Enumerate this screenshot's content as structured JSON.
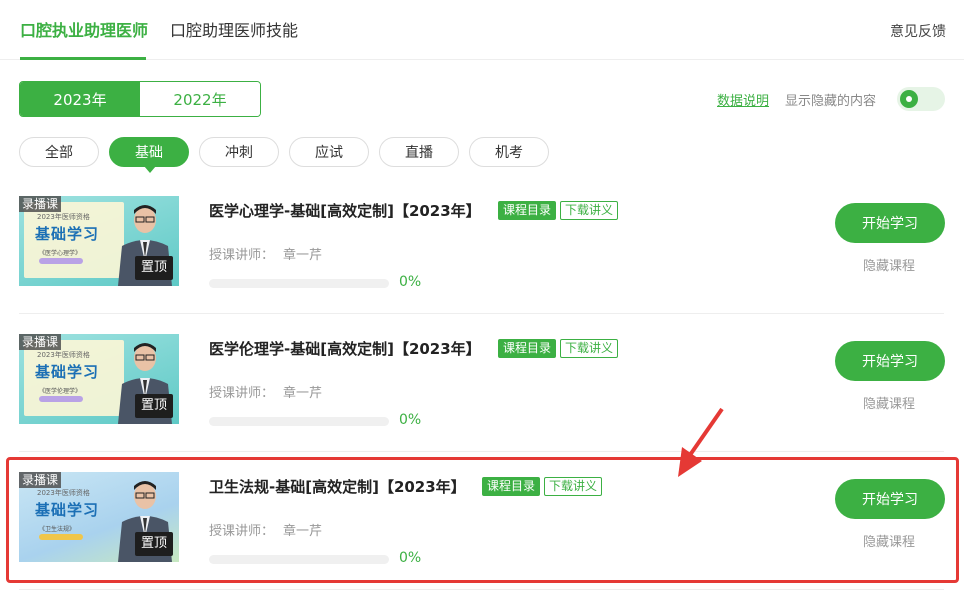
{
  "top_tabs": [
    {
      "label": "口腔执业助理医师",
      "active": true
    },
    {
      "label": "口腔助理医师技能",
      "active": false
    }
  ],
  "feedback_label": "意见反馈",
  "year_switch": [
    {
      "label": "2023年",
      "active": true
    },
    {
      "label": "2022年",
      "active": false
    }
  ],
  "data_explain_label": "数据说明",
  "show_hidden_label": "显示隐藏的内容",
  "categories": [
    {
      "label": "全部",
      "active": false
    },
    {
      "label": "基础",
      "active": true
    },
    {
      "label": "冲刺",
      "active": false
    },
    {
      "label": "应试",
      "active": false
    },
    {
      "label": "直播",
      "active": false
    },
    {
      "label": "机考",
      "active": false
    }
  ],
  "courses": [
    {
      "badge": "录播课",
      "pin": "置顶",
      "thumb_year": "2023年医师资格",
      "thumb_title": "基础学习",
      "thumb_sub": "《医学心理学》",
      "title": "医学心理学-基础[高效定制]【2023年】",
      "tag_catalog": "课程目录",
      "tag_download": "下载讲义",
      "teacher_label": "授课讲师：",
      "teacher_name": "章一芹",
      "progress_pct": "0%",
      "progress_value": 0,
      "start_label": "开始学习",
      "hide_label": "隐藏课程"
    },
    {
      "badge": "录播课",
      "pin": "置顶",
      "thumb_year": "2023年医师资格",
      "thumb_title": "基础学习",
      "thumb_sub": "《医学伦理学》",
      "title": "医学伦理学-基础[高效定制]【2023年】",
      "tag_catalog": "课程目录",
      "tag_download": "下载讲义",
      "teacher_label": "授课讲师：",
      "teacher_name": "章一芹",
      "progress_pct": "0%",
      "progress_value": 0,
      "start_label": "开始学习",
      "hide_label": "隐藏课程"
    },
    {
      "badge": "录播课",
      "pin": "置顶",
      "thumb_year": "2023年医师资格",
      "thumb_title": "基础学习",
      "thumb_sub": "《卫生法规》",
      "title": "卫生法规-基础[高效定制]【2023年】",
      "tag_catalog": "课程目录",
      "tag_download": "下载讲义",
      "teacher_label": "授课讲师：",
      "teacher_name": "章一芹",
      "progress_pct": "0%",
      "progress_value": 0,
      "start_label": "开始学习",
      "hide_label": "隐藏课程"
    }
  ],
  "colors": {
    "accent": "#3cb043",
    "annotation": "#e53935"
  }
}
